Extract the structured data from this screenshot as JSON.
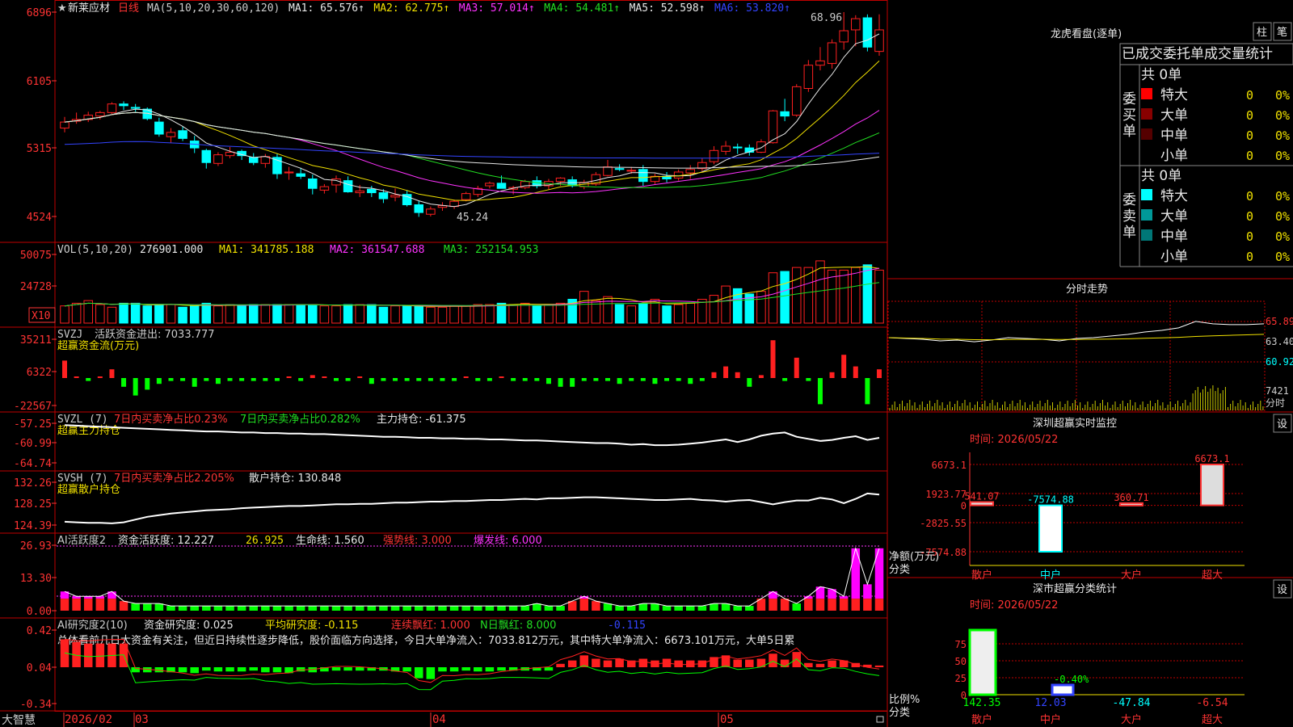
{
  "stock": {
    "star": "★",
    "name": "新莱应材",
    "period": "日线"
  },
  "ma_header": {
    "params": "MA(5,10,20,30,60,120)",
    "items": [
      {
        "label": "MA1:",
        "value": "65.576",
        "arrow": "↑",
        "color": "#e8e8e8"
      },
      {
        "label": "MA2:",
        "value": "62.775",
        "arrow": "↑",
        "color": "#f0e000"
      },
      {
        "label": "MA3:",
        "value": "57.014",
        "arrow": "↑",
        "color": "#ff33ff"
      },
      {
        "label": "MA4:",
        "value": "54.481",
        "arrow": "↑",
        "color": "#22dd22"
      },
      {
        "label": "MA5:",
        "value": "52.598",
        "arrow": "↑",
        "color": "#e8e8e8"
      },
      {
        "label": "MA6:",
        "value": "53.820",
        "arrow": "↑",
        "color": "#3344ff"
      }
    ]
  },
  "price_axis": [
    "6896",
    "6105",
    "5315",
    "4524"
  ],
  "price_marks": {
    "high": "68.96",
    "low": "45.24"
  },
  "vol_header": {
    "params": "VOL(5,10,20)",
    "vol": "276901.000",
    "ma1": "MA1: 341785.188",
    "ma2": "MA2: 361547.688",
    "ma3": "MA3: 252154.953"
  },
  "vol_axis": [
    "50075",
    "24728"
  ],
  "vol_unit": "X10",
  "svzj": {
    "title": "SVZJ",
    "label": "活跃资金进出: 7033.777",
    "sub": "超赢资金流(万元)",
    "axis": [
      "35211",
      "6322",
      "-22567"
    ]
  },
  "svzl": {
    "title": "SVZL (7)",
    "a": "7日内买卖净占比0.23%",
    "b": "7日内买卖净占比0.282%",
    "c": "主力持仓: -61.375",
    "sub": "超赢主力持仓",
    "axis": [
      "-57.25",
      "-60.99",
      "-64.74"
    ]
  },
  "svsh": {
    "title": "SVSH (7)",
    "a": "7日内买卖净占比2.205%",
    "c": "散户持仓: 130.848",
    "sub": "超赢散户持仓",
    "axis": [
      "132.26",
      "128.25",
      "124.39"
    ]
  },
  "ai1": {
    "title": "AI活跃度2",
    "a": "资金活跃度: 12.227",
    "b": "26.925",
    "c": "生命线: 1.560",
    "d": "强势线: 3.000",
    "e": "爆发线: 6.000",
    "axis": [
      "26.93",
      "13.30",
      "0.00"
    ]
  },
  "ai2": {
    "title": "AI研究度2(10)",
    "a": "资金研究度: 0.025",
    "b": "平均研究度: -0.115",
    "c": "连续飘红: 1.000",
    "d": "N日飘红: 8.000",
    "e": "-0.115",
    "axis": [
      "0.42",
      "0.04",
      "-0.34"
    ]
  },
  "analysis": "总体看前几日大资金有关注，但近日持续性逐步降低，股价面临方向选择，今日大单净流入：7033.812万元，其中特大单净流入：6673.101万元，大单5日累",
  "time_axis": {
    "brand": "大智慧",
    "labels": [
      "2026/02",
      "03",
      "04",
      "05"
    ]
  },
  "right": {
    "title": "龙虎看盘(逐单)",
    "btn1": "柱",
    "btn2": "笔",
    "table_title": "已成交委托单成交量统计",
    "buy": {
      "side": "委买单",
      "total": "共 0单",
      "rows": [
        {
          "name": "特大",
          "val": "0",
          "pct": "0%",
          "color": "#ff0000"
        },
        {
          "name": "大单",
          "val": "0",
          "pct": "0%",
          "color": "#880000"
        },
        {
          "name": "中单",
          "val": "0",
          "pct": "0%",
          "color": "#550000"
        },
        {
          "name": "小单",
          "val": "0",
          "pct": "0%",
          "color": ""
        }
      ]
    },
    "sell": {
      "side": "委卖单",
      "total": "共 0单",
      "rows": [
        {
          "name": "特大",
          "val": "0",
          "pct": "0%",
          "color": "#00ffff"
        },
        {
          "name": "大单",
          "val": "0",
          "pct": "0%",
          "color": "#009999"
        },
        {
          "name": "中单",
          "val": "0",
          "pct": "0%",
          "color": "#007777"
        },
        {
          "name": "小单",
          "val": "0",
          "pct": "0%",
          "color": ""
        }
      ]
    }
  },
  "intraday": {
    "title": "分时走势",
    "axis": [
      "65.89",
      "63.40",
      "60.92"
    ],
    "vol": "7421",
    "vol_unit": "分时"
  },
  "monitor": {
    "title": "深圳超赢实时监控",
    "btn": "设",
    "time": "时间: 2026/05/22",
    "axis": [
      "6673.1",
      "1923.77",
      "0",
      "-2825.55",
      "-7574.88"
    ],
    "ylabel": "净额(万元)",
    "xlabel": "分类",
    "cats": [
      "散户",
      "中户",
      "大户",
      "超大"
    ],
    "value_labels": [
      "541.07",
      "-7574.88",
      "360.71",
      "6673.1"
    ]
  },
  "classify": {
    "title": "深市超赢分类统计",
    "btn": "设",
    "time": "时间: 2026/05/22",
    "axis": [
      "75",
      "50",
      "25",
      "0"
    ],
    "ylabel": "比例%",
    "xlabel": "分类",
    "cats": [
      "散户",
      "中户",
      "大户",
      "超大"
    ],
    "value_labels": [
      "142.35",
      "12.03",
      "-47.84",
      "-6.54"
    ],
    "mid_label": "-0.40%"
  },
  "colors": {
    "up": "#ff2020",
    "down": "#00ffff",
    "frame": "#c00000",
    "green": "#00ff00",
    "magenta": "#ff00ff",
    "yellow": "#f0e000"
  },
  "chart_data": {
    "type": "candlestick",
    "title": "新莱应材 日线",
    "y_ticks": [
      4524,
      5315,
      6105,
      6896
    ],
    "high": 68.96,
    "low": 45.24,
    "candles_ohlc": [
      [
        55.5,
        56.8,
        55.0,
        56.2
      ],
      [
        56.3,
        57.3,
        56.0,
        56.5
      ],
      [
        56.5,
        57.4,
        56.2,
        57.0
      ],
      [
        56.9,
        57.5,
        56.5,
        57.3
      ],
      [
        57.3,
        58.5,
        57.1,
        58.3
      ],
      [
        58.3,
        58.6,
        57.6,
        58.1
      ],
      [
        57.9,
        58.3,
        57.4,
        57.8
      ],
      [
        57.7,
        57.9,
        56.4,
        56.6
      ],
      [
        56.2,
        56.7,
        54.5,
        54.8
      ],
      [
        54.5,
        55.5,
        53.8,
        55.0
      ],
      [
        55.2,
        55.7,
        54.0,
        54.3
      ],
      [
        54.0,
        54.6,
        52.6,
        53.2
      ],
      [
        52.9,
        53.1,
        50.8,
        51.5
      ],
      [
        51.4,
        52.7,
        51.1,
        52.4
      ],
      [
        52.3,
        53.3,
        52.0,
        52.7
      ],
      [
        52.8,
        53.0,
        51.8,
        52.3
      ],
      [
        52.1,
        52.6,
        51.2,
        51.5
      ],
      [
        51.4,
        52.5,
        50.9,
        52.2
      ],
      [
        52.1,
        52.5,
        49.6,
        50.2
      ],
      [
        50.3,
        51.0,
        49.5,
        50.4
      ],
      [
        50.2,
        50.9,
        49.6,
        49.9
      ],
      [
        49.6,
        50.1,
        47.8,
        48.5
      ],
      [
        48.3,
        49.0,
        47.9,
        48.7
      ],
      [
        48.9,
        50.0,
        48.0,
        49.6
      ],
      [
        49.4,
        49.9,
        48.0,
        48.1
      ],
      [
        48.0,
        48.9,
        47.5,
        48.2
      ],
      [
        48.4,
        48.8,
        47.5,
        48.0
      ],
      [
        48.0,
        48.4,
        46.8,
        47.3
      ],
      [
        47.5,
        48.5,
        47.0,
        47.7
      ],
      [
        47.8,
        48.3,
        46.4,
        46.6
      ],
      [
        46.6,
        47.1,
        45.2,
        45.7
      ],
      [
        45.5,
        46.4,
        45.24,
        46.1
      ],
      [
        46.3,
        46.9,
        45.9,
        46.5
      ],
      [
        46.4,
        47.2,
        46.1,
        47.0
      ],
      [
        47.2,
        48.1,
        47.0,
        47.9
      ],
      [
        47.8,
        48.8,
        47.5,
        48.5
      ],
      [
        48.8,
        49.3,
        48.5,
        49.1
      ],
      [
        49.1,
        50.0,
        48.7,
        48.5
      ],
      [
        48.4,
        48.8,
        47.8,
        48.6
      ],
      [
        48.6,
        49.5,
        48.4,
        49.3
      ],
      [
        49.4,
        49.9,
        48.5,
        48.8
      ],
      [
        48.8,
        49.6,
        48.4,
        49.3
      ],
      [
        49.3,
        49.8,
        48.8,
        49.7
      ],
      [
        49.5,
        49.9,
        48.6,
        48.8
      ],
      [
        48.7,
        49.5,
        48.4,
        49.2
      ],
      [
        49.0,
        50.4,
        48.8,
        50.1
      ],
      [
        50.0,
        51.8,
        49.9,
        51.0
      ],
      [
        50.8,
        51.3,
        50.5,
        50.7
      ],
      [
        50.6,
        51.0,
        50.2,
        50.6
      ],
      [
        50.7,
        51.2,
        48.8,
        49.3
      ],
      [
        49.3,
        50.2,
        49.0,
        49.9
      ],
      [
        49.9,
        50.4,
        49.2,
        49.6
      ],
      [
        49.7,
        50.7,
        49.4,
        50.4
      ],
      [
        50.3,
        51.2,
        49.6,
        50.7
      ],
      [
        50.8,
        52.0,
        50.5,
        51.5
      ],
      [
        51.6,
        53.4,
        51.3,
        52.9
      ],
      [
        52.8,
        54.0,
        52.4,
        53.4
      ],
      [
        53.3,
        53.7,
        52.5,
        53.2
      ],
      [
        53.2,
        53.6,
        52.3,
        52.7
      ],
      [
        52.7,
        54.2,
        52.6,
        53.9
      ],
      [
        53.8,
        57.6,
        53.7,
        57.5
      ],
      [
        57.4,
        58.9,
        56.3,
        56.9
      ],
      [
        57.0,
        60.6,
        56.8,
        60.3
      ],
      [
        60.1,
        63.4,
        59.7,
        62.8
      ],
      [
        62.8,
        64.9,
        62.2,
        63.3
      ],
      [
        63.0,
        65.8,
        62.4,
        65.4
      ],
      [
        65.5,
        68.96,
        64.6,
        66.8
      ],
      [
        66.9,
        68.6,
        65.0,
        68.2
      ],
      [
        68.3,
        68.7,
        64.4,
        64.9
      ],
      [
        64.4,
        68.7,
        63.9,
        66.9
      ]
    ],
    "volume": [
      13,
      15,
      17,
      14,
      12,
      15,
      15,
      13,
      14,
      14,
      12,
      13,
      15,
      13,
      14,
      13,
      14,
      14,
      14,
      14,
      14,
      14,
      13,
      13,
      14,
      14,
      14,
      12,
      13,
      13,
      13,
      12,
      12,
      13,
      13,
      14,
      14,
      15,
      14,
      15,
      13,
      14,
      15,
      18,
      24,
      17,
      20,
      14,
      13,
      15,
      18,
      13,
      14,
      15,
      18,
      21,
      28,
      26,
      22,
      24,
      38,
      39,
      42,
      42,
      47,
      40,
      40,
      42,
      44,
      40
    ],
    "svzj": [
      6,
      0,
      -1,
      0,
      3,
      -3,
      -6,
      -4,
      -2,
      -1,
      -1,
      -3,
      -1,
      -2,
      -1,
      -1,
      -1,
      -1,
      -1,
      0,
      -1,
      1,
      0,
      -1,
      -1,
      0,
      -2,
      -1,
      -1,
      -1,
      -1,
      -1,
      -1,
      -1,
      0,
      -1,
      -1,
      0,
      -1,
      -1,
      -1,
      -2,
      -3,
      -3,
      -1,
      -1,
      -1,
      -2,
      -1,
      -1,
      -2,
      -1,
      -1,
      -2,
      -1,
      2,
      4,
      2,
      -3,
      1,
      13,
      -1,
      7,
      -1,
      -9,
      2,
      8,
      4,
      -9,
      3
    ],
    "svzl": [
      -57.6,
      -57.7,
      -57.8,
      -57.9,
      -58.0,
      -58.1,
      -58.2,
      -58.3,
      -58.4,
      -58.5,
      -58.6,
      -58.7,
      -58.8,
      -58.8,
      -58.9,
      -59.0,
      -59.0,
      -59.1,
      -59.1,
      -59.2,
      -59.2,
      -59.3,
      -59.3,
      -59.4,
      -59.5,
      -59.6,
      -59.7,
      -59.8,
      -59.8,
      -59.9,
      -60.0,
      -60.0,
      -60.1,
      -60.1,
      -60.2,
      -60.2,
      -60.3,
      -60.3,
      -60.4,
      -60.5,
      -60.5,
      -60.6,
      -60.7,
      -60.8,
      -60.9,
      -61.0,
      -61.0,
      -61.1,
      -61.3,
      -61.2,
      -61.4,
      -61.4,
      -61.3,
      -61.1,
      -60.9,
      -60.6,
      -60.3,
      -60.8,
      -60.3,
      -59.6,
      -59.2,
      -59.0,
      -59.8,
      -60.2,
      -60.6,
      -60.4,
      -60.0,
      -59.7,
      -60.4,
      -60.0
    ],
    "svsh": [
      125.0,
      124.9,
      124.8,
      124.8,
      124.7,
      124.9,
      125.4,
      125.9,
      126.2,
      126.5,
      126.7,
      126.9,
      127.1,
      127.2,
      127.3,
      127.5,
      127.6,
      127.7,
      127.8,
      127.9,
      127.9,
      128.0,
      128.1,
      128.2,
      128.2,
      128.3,
      128.3,
      128.4,
      128.5,
      128.5,
      128.6,
      128.7,
      128.7,
      128.8,
      128.8,
      128.9,
      129.0,
      129.0,
      129.1,
      129.2,
      129.1,
      129.3,
      129.3,
      129.4,
      129.5,
      129.5,
      129.4,
      129.3,
      129.2,
      129.1,
      129.0,
      129.0,
      129.1,
      129.2,
      129.0,
      128.9,
      128.7,
      128.9,
      129.0,
      128.6,
      128.2,
      128.6,
      128.9,
      128.9,
      129.4,
      129.1,
      128.4,
      129.2,
      130.2,
      130.0
    ],
    "ai_activity": [
      8,
      6,
      6,
      6,
      8,
      4,
      3,
      3,
      3,
      2,
      2,
      2,
      2,
      2,
      2,
      2,
      2,
      2,
      2,
      2,
      2,
      2,
      2,
      2,
      2,
      2,
      2,
      2,
      2,
      2,
      2,
      2,
      2,
      2,
      2,
      2,
      2,
      2,
      2,
      2,
      3,
      2,
      2,
      4,
      6,
      4,
      3,
      2,
      2,
      3,
      3,
      2,
      2,
      2,
      2,
      3,
      3,
      2,
      2,
      5,
      8,
      5,
      3,
      6,
      10,
      9,
      6,
      26,
      11,
      26,
      20,
      16,
      17,
      15,
      12
    ],
    "ai_research": [
      0.33,
      0.3,
      0.28,
      0.28,
      0.28,
      0.28,
      -0.06,
      -0.06,
      -0.06,
      -0.06,
      -0.06,
      -0.07,
      -0.04,
      -0.05,
      -0.05,
      -0.05,
      -0.04,
      -0.06,
      -0.06,
      -0.07,
      -0.05,
      -0.06,
      -0.05,
      -0.04,
      -0.04,
      -0.04,
      -0.04,
      -0.04,
      -0.05,
      -0.05,
      -0.13,
      -0.14,
      -0.05,
      -0.05,
      -0.04,
      -0.05,
      -0.05,
      -0.04,
      -0.04,
      -0.04,
      -0.04,
      -0.04,
      0.04,
      0.08,
      0.14,
      0.1,
      0.08,
      0.1,
      0.08,
      0.1,
      0.08,
      0.1,
      0.08,
      0.08,
      0.08,
      0.12,
      0.14,
      0.09,
      0.09,
      0.1,
      0.16,
      0.09,
      0.18,
      0.05,
      0.04,
      0.08,
      0.08,
      0.05,
      0.03,
      0.02
    ],
    "intraday_price": [
      63.9,
      63.8,
      63.7,
      63.5,
      63.6,
      63.4,
      63.6,
      63.9,
      63.8,
      63.7,
      63.5,
      63.8,
      63.9,
      64.1,
      64.3,
      64.6,
      64.8,
      65.1,
      65.9,
      65.6,
      65.5,
      65.5,
      65.6
    ],
    "monitor_values": [
      541.07,
      -7574.88,
      360.71,
      6673.1
    ],
    "classify_values": [
      142.35,
      12.03,
      -47.84,
      -6.54
    ]
  }
}
